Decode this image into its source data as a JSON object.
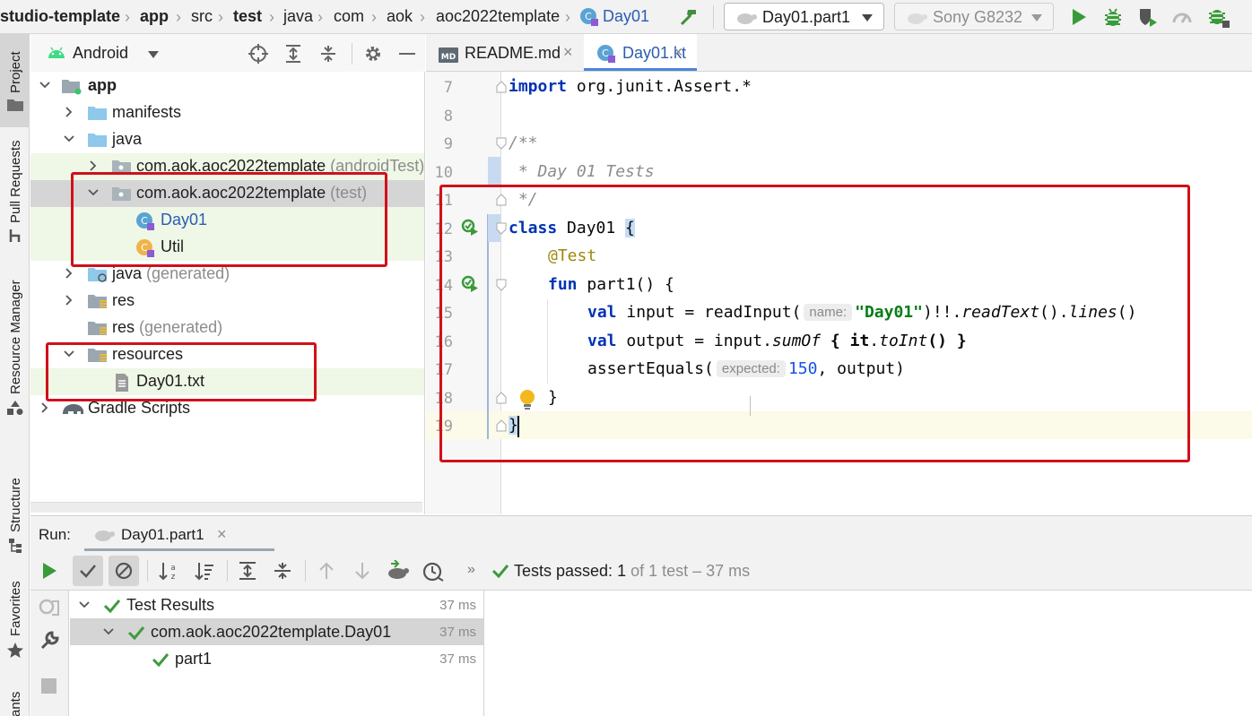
{
  "breadcrumb": [
    "studio-template",
    "app",
    "src",
    "test",
    "java",
    "com",
    "aok",
    "aoc2022template",
    "Day01"
  ],
  "run_config": {
    "selected": "Day01.part1"
  },
  "device": {
    "selected": "Sony G8232"
  },
  "left_strip": {
    "project": "Project",
    "pull_requests": "Pull Requests",
    "resource_manager": "Resource Manager",
    "structure": "Structure",
    "favorites": "Favorites",
    "ants": "ants"
  },
  "project_pane": {
    "view_mode": "Android"
  },
  "tree": [
    {
      "label": "app",
      "suffix": ""
    },
    {
      "label": "manifests",
      "suffix": ""
    },
    {
      "label": "java",
      "suffix": ""
    },
    {
      "label": "com.aok.aoc2022template",
      "suffix": "(androidTest)"
    },
    {
      "label": "com.aok.aoc2022template",
      "suffix": "(test)"
    },
    {
      "label": "Day01",
      "suffix": ""
    },
    {
      "label": "Util",
      "suffix": ""
    },
    {
      "label": "java",
      "suffix": "(generated)"
    },
    {
      "label": "res",
      "suffix": ""
    },
    {
      "label": "res",
      "suffix": "(generated)"
    },
    {
      "label": "resources",
      "suffix": ""
    },
    {
      "label": "Day01.txt",
      "suffix": ""
    },
    {
      "label": "Gradle Scripts",
      "suffix": ""
    }
  ],
  "editor_tabs": [
    {
      "label": "README.md",
      "badge": "MD"
    },
    {
      "label": "Day01.kt",
      "badge": ""
    }
  ],
  "editor": {
    "line_numbers": [
      "7",
      "8",
      "9",
      "10",
      "11",
      "12",
      "13",
      "14",
      "15",
      "16",
      "17",
      "18",
      "19"
    ],
    "code": {
      "import_kw": "import",
      "import_path": " org.junit.Assert.*",
      "doc_open": "/**",
      "doc_body": " * Day 01 Tests",
      "doc_close": " */",
      "class_kw": "class",
      "class_name": " Day01 ",
      "class_brace": "{",
      "annotation": "@Test",
      "fun_kw": "fun",
      "fun_sig": " part1() {",
      "val_kw": "val",
      "l15_a": " input = readInput(",
      "l15_hint": "name:",
      "l15_str": "\"Day01\"",
      "l15_b": ")!!.",
      "l15_read": "readText",
      "l15_c": "().",
      "l15_lines": "lines",
      "l15_d": "()",
      "l16_a": " output = input.",
      "l16_sum": "sumOf",
      "l16_b": " { ",
      "l16_it": "it",
      "l16_c": ".",
      "l16_toint": "toInt",
      "l16_d": "() }",
      "l17_a": "assertEquals(",
      "l17_hint": "expected:",
      "l17_num": "150",
      "l17_b": ", output)",
      "l18": "}",
      "l19": "}"
    }
  },
  "run_panel": {
    "title": "Run:",
    "tab": "Day01.part1",
    "status_prefix": "Tests passed:",
    "status_count": "1",
    "status_suffix": "of 1 test – 37 ms"
  },
  "test_results": [
    {
      "label": "Test Results",
      "time": "37 ms"
    },
    {
      "label": "com.aok.aoc2022template.Day01",
      "time": "37 ms"
    },
    {
      "label": "part1",
      "time": "37 ms"
    }
  ],
  "colors": {
    "accent_red": "#d0101a",
    "pass_green": "#3f9a3f",
    "test_bg": "#eff7e6",
    "selection": "#d5d5d5",
    "link_blue": "#2a5db0"
  }
}
